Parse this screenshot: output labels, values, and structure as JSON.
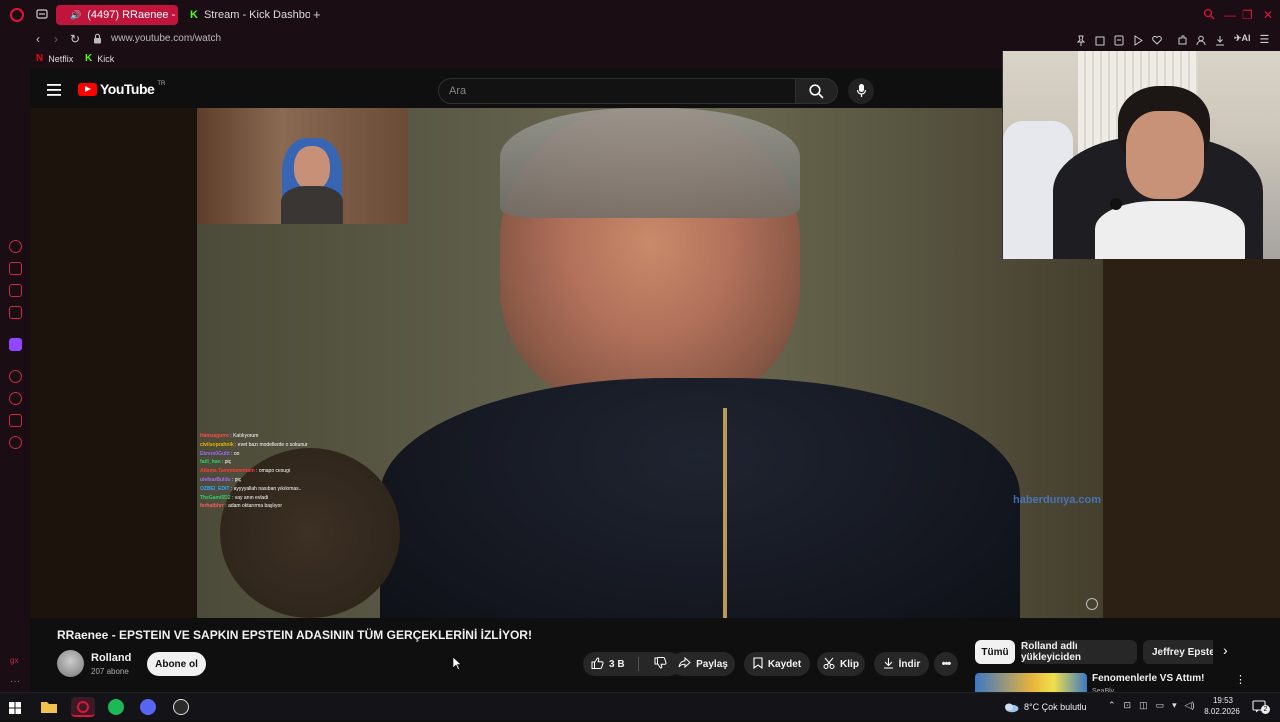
{
  "browser": {
    "tabs": [
      {
        "label": "(4497) RRaenee - EPS",
        "active": true
      },
      {
        "label": "Stream - Kick Dashboard",
        "active": false
      }
    ],
    "new_tab": "+",
    "url": "www.youtube.com/watch",
    "bookmarks": [
      {
        "label": "Netflix"
      },
      {
        "label": "Kick"
      }
    ],
    "ai_label": "AI"
  },
  "youtube": {
    "logo_text": "YouTube",
    "region": "TR",
    "search_placeholder": "Ara",
    "video_title": "RRaenee - EPSTEIN VE SAPKIN EPSTEIN ADASININ TÜM GERÇEKLERİNİ İZLİYOR!",
    "channel": {
      "name": "Rolland",
      "subs": "207 abone"
    },
    "subscribe_label": "Abone ol",
    "actions": {
      "likes": "3 B",
      "share": "Paylaş",
      "save": "Kaydet",
      "clip": "Klip",
      "download": "İndir"
    },
    "chips": [
      "Tümü",
      "Rolland adlı yükleyiciden",
      "Jeffrey Epste"
    ],
    "recommended": {
      "title": "Fenomenlerle VS Attım!",
      "channel": "SeaBly"
    },
    "watermark": "haberdunya.com"
  },
  "stream_chat": [
    {
      "user": "Hamzagurre",
      "msg": ": Katılıyorum",
      "color": "#ff4b4b"
    },
    {
      "user": "civilsoprahnik",
      "msg": ": evet bazı modellerde o sokunur",
      "color": "#e6b800"
    },
    {
      "user": "Ekrem0Gultt",
      "msg": ": oo",
      "color": "#9b6bff"
    },
    {
      "user": "fatli_han",
      "msg": ": piç",
      "color": "#2bd46b"
    },
    {
      "user": "Atlama Tammtammtam",
      "msg": ": omapo cesugi",
      "color": "#ff3b3b"
    },
    {
      "user": "ulefsarBuldu",
      "msg": ": piç",
      "color": "#a66bff"
    },
    {
      "user": "OZBEI_EDIT",
      "msg": ": ayyyyallah nasıban yıkılomas..",
      "color": "#39a3ff"
    },
    {
      "user": "TheGami5D2",
      "msg": ": vay anın evladi",
      "color": "#2bd46b"
    },
    {
      "user": "ferhatbhrr",
      "msg": ": adam oktarırma başlıyor",
      "color": "#ff5a5a"
    },
    {
      "user": "Muhat.ilhan",
      "msg": "takip etmeye başladı!",
      "color": "#ff4b4b"
    }
  ],
  "taskbar": {
    "weather": "8°C Çok bulutlu",
    "time": "19:53",
    "date": "8.02.2026",
    "notif_count": "2"
  },
  "colors": {
    "accent": "#c0143c",
    "yt_red": "#ff0000",
    "bg": "#0f0f0f"
  }
}
